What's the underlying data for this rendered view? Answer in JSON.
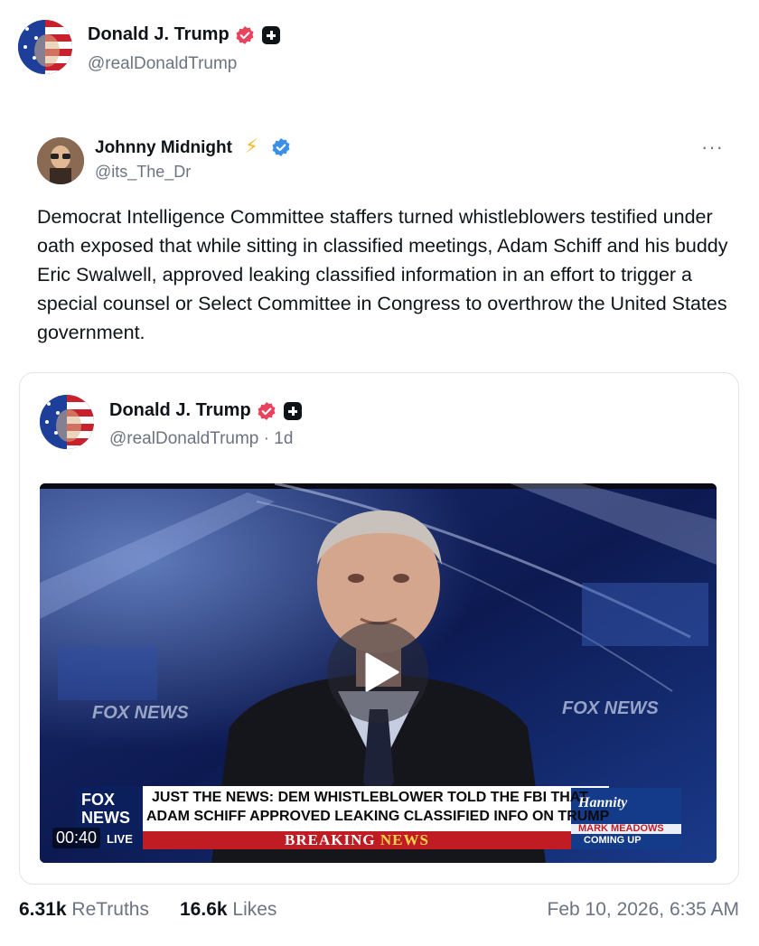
{
  "post": {
    "author_name": "Donald J. Trump",
    "author_handle": "@realDonaldTrump",
    "author_avatar_icon": "flag-portrait-avatar",
    "verified_icon": "verified-badge-icon",
    "plus_icon": "plus-badge-icon"
  },
  "retruth": {
    "author_name": "Johnny Midnight",
    "author_emoji": "⚡",
    "author_handle": "@its_The_Dr",
    "more_label": "···",
    "text": "Democrat Intelligence Committee staffers turned whistleblowers testified under oath exposed that while sitting in classified meetings, Adam Schiff and his buddy Eric Swalwell, approved leaking classified information in an effort to trigger a special counsel or Select Committee in Congress to overthrow the United States government."
  },
  "quoted": {
    "author_name": "Donald J. Trump",
    "author_handle": "@realDonaldTrump · 1d",
    "video": {
      "timecode": "00:40",
      "watermark_left": "FOX NEWS",
      "watermark_right": "FOX NEWS",
      "logo_line1": "FOX",
      "logo_line2": "NEWS",
      "logo_line3": "LIVE",
      "headline_line1": "JUST THE NEWS: DEM WHISTLEBLOWER TOLD THE FBI THAT",
      "headline_line2": "ADAM SCHIFF APPROVED LEAKING CLASSIFIED INFO ON TRUMP",
      "banner_breaking": "BREAKING",
      "banner_news": "NEWS",
      "promo_show": "Hannity",
      "promo_line1": "MARK MEADOWS",
      "promo_line2": "COMING UP"
    }
  },
  "stats": {
    "retruths_count": "6.31k",
    "retruths_label": "ReTruths",
    "likes_count": "16.6k",
    "likes_label": "Likes",
    "timestamp": "Feb 10, 2026, 6:35 AM"
  },
  "colors": {
    "verified_badge": "#e8425d",
    "blue_check": "#3a8fe6",
    "text_primary": "#0f1419",
    "text_secondary": "#6b7480"
  }
}
